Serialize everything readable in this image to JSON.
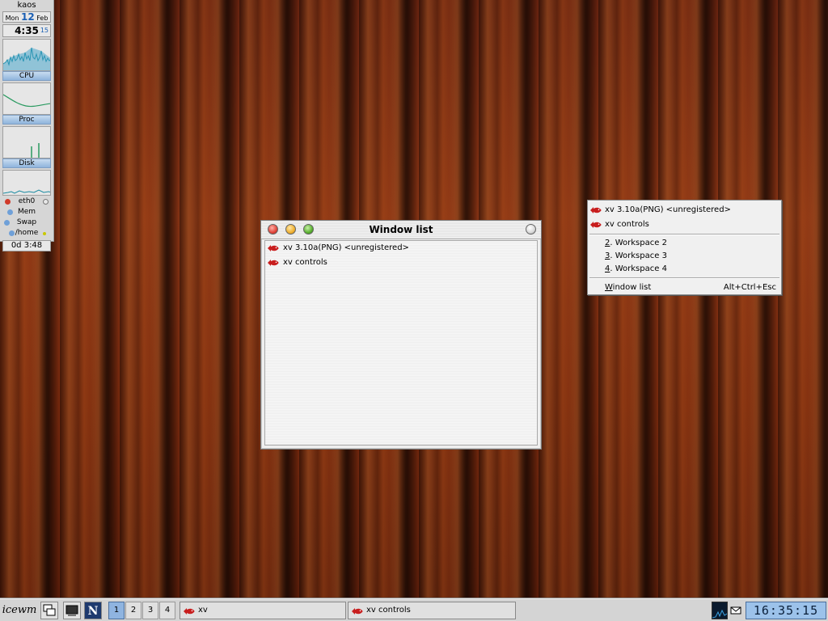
{
  "monitor": {
    "host": "kaos",
    "weekday": "Mon",
    "day": "12",
    "month": "Feb",
    "time": "4:35",
    "seconds": "15",
    "labels": {
      "cpu": "CPU",
      "proc": "Proc",
      "disk": "Disk",
      "net": "eth0",
      "mem": "Mem",
      "swap": "Swap",
      "home": "/home"
    },
    "uptime": "0d  3:48"
  },
  "window_list": {
    "title": "Window list",
    "items": [
      {
        "label": "xv 3.10a(PNG) <unregistered>",
        "icon": "fish-icon"
      },
      {
        "label": "xv controls",
        "icon": "fish-icon"
      }
    ]
  },
  "menu": {
    "windows": [
      {
        "label": "xv 3.10a(PNG) <unregistered>",
        "icon": "fish-icon"
      },
      {
        "label": "xv controls",
        "icon": "fish-icon"
      }
    ],
    "workspaces": [
      {
        "num": "2",
        "label": ". Workspace  2"
      },
      {
        "num": "3",
        "label": ". Workspace  3"
      },
      {
        "num": "4",
        "label": ". Workspace  4"
      }
    ],
    "window_list": {
      "label_first": "W",
      "label_rest": "indow list",
      "accel": "Alt+Ctrl+Esc"
    }
  },
  "taskbar": {
    "start_label": "icewm",
    "workspaces": [
      "1",
      "2",
      "3",
      "4"
    ],
    "active_workspace": "1",
    "tasks": [
      {
        "label": "xv",
        "icon": "fish-icon"
      },
      {
        "label": "xv controls",
        "icon": "fish-icon"
      }
    ],
    "clock": "16:35:15"
  },
  "colors": {
    "accent": "#8fb4e0",
    "close": "#e0443a",
    "minimize": "#f0b030",
    "maximize": "#5ab030",
    "fish": "#c81e1e"
  }
}
